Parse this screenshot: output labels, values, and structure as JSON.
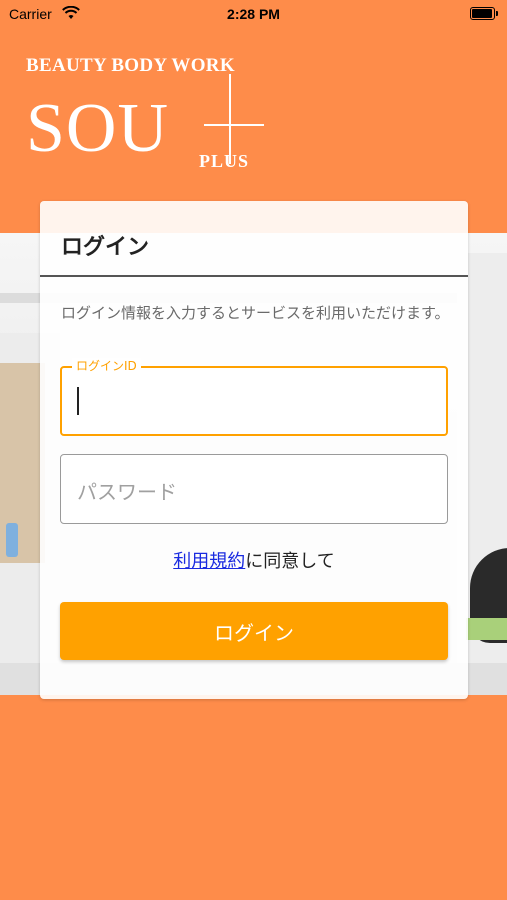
{
  "status_bar": {
    "carrier": "Carrier",
    "time": "2:28 PM"
  },
  "logo": {
    "top_text": "BEAUTY BODY WORK",
    "main_text": "SOU",
    "plus_text": "PLUS"
  },
  "login": {
    "title": "ログイン",
    "description": "ログイン情報を入力するとサービスを利用いただけます。",
    "login_id_label": "ログインID",
    "login_id_value": "",
    "password_placeholder": "パスワード",
    "terms_link": "利用規約",
    "terms_suffix": "に同意して",
    "button_label": "ログイン"
  },
  "colors": {
    "background": "#FE8C4A",
    "accent": "#FFA100",
    "link": "#1A2BE0"
  }
}
